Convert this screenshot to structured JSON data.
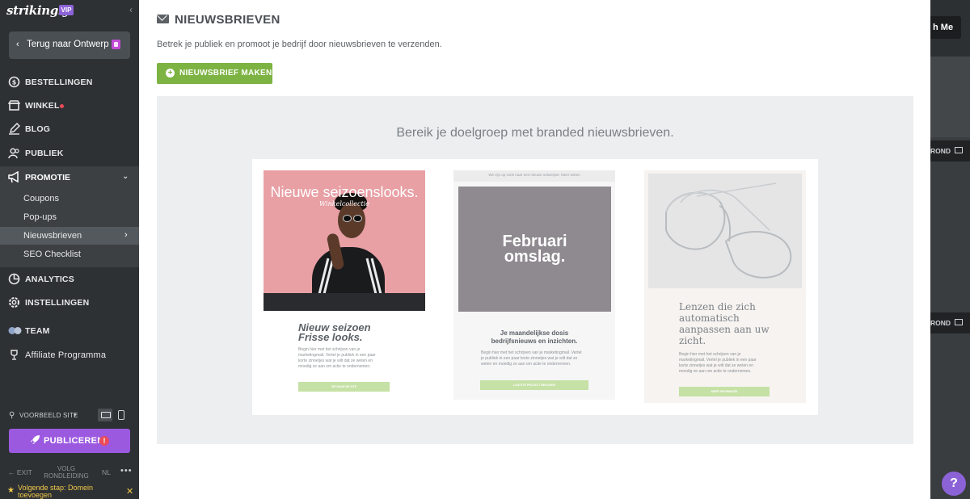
{
  "sidebar": {
    "logo": "strikingly",
    "vip_badge": "VIP",
    "back_button": "Terug naar Ontwerp",
    "items": [
      {
        "label": "BESTELLINGEN",
        "icon": "dollar-circle-icon"
      },
      {
        "label": "WINKEL",
        "icon": "store-icon",
        "dot": true
      },
      {
        "label": "BLOG",
        "icon": "pen-icon"
      },
      {
        "label": "PUBLIEK",
        "icon": "people-icon"
      }
    ],
    "promotion": {
      "label": "PROMOTIE",
      "icon": "megaphone-icon",
      "sub_items": [
        "Coupons",
        "Pop-ups",
        "Nieuwsbrieven",
        "SEO Checklist"
      ],
      "active": "Nieuwsbrieven"
    },
    "items_after": [
      {
        "label": "ANALYTICS",
        "icon": "pie-chart-icon"
      },
      {
        "label": "INSTELLINGEN",
        "icon": "gear-icon"
      },
      {
        "label": "TEAM",
        "icon": "team-icon"
      },
      {
        "label": "Affiliate Programma",
        "icon": "trophy-icon"
      }
    ],
    "preview_label": "VOORBEELD SITE",
    "publish_label": "PUBLICEREN",
    "publish_warning": "!",
    "exit_label": "EXIT",
    "tour_label": "VOLG RONDLEIDING",
    "lang_label": "NL",
    "more_label": "•••",
    "next_step": "Volgende stap: Domein toevoegen"
  },
  "background": {
    "button_fragment": "h Me",
    "label_fragment_1": "ROND",
    "label_fragment_2": "ROND"
  },
  "help_label": "?",
  "main": {
    "title": "NIEUWSBRIEVEN",
    "subtitle": "Betrek je publiek en promoot je bedrijf door nieuwsbrieven te verzenden.",
    "make_button": "NIEUWSBRIEF MAKEN",
    "promo_heading": "Bereik je doelgroep met branded nieuwsbrieven.",
    "cards": [
      {
        "image_heading": "Nieuwe seizoenslooks.",
        "image_sub": "Winkelcollectie",
        "title": "Nieuw seizoen\nFrisse looks.",
        "body": "Begin hier met het schrijven van je\nmarketingmail. Vertel je publiek in een paar\nkorte zinnetjes wat je wilt dat ze weten en\nmoedig ze aan om actie te ondernemen.",
        "button": "ZIE NAAR DE SITE"
      },
      {
        "top_bar": "We zijn op zoek naar een nieuwe ontwerper. Meer weten",
        "image_heading": "Februari\nomslag.",
        "title": "Je maandelijkse dosis\nbedrijfsnieuws en inzichten.",
        "body": "Begin hier met het schrijven van je marketingmail. Vertel\nje publiek in een paar korte zinnetjes wat je wilt dat ze\nweten en moedig ze aan om actie te ondernemen.",
        "button": "LAATSTE PROJECT BEKIJKEN"
      },
      {
        "title": "Lenzen die zich\nautomatisch\naanpassen aan uw\nzicht.",
        "body": "Begin hier met het schrijven van je\nmarketingmail. Vertel je publiek in een paar\nkorte zinnetjes wat je wilt dat ze weten en\nmoedig ze aan om actie te ondernemen.",
        "button": "MEER INFORMATIE"
      }
    ]
  },
  "colors": {
    "sidebar_bg": "#2e3133",
    "promo_bg": "#3c4043",
    "active_item_bg": "#54595d",
    "accent_purple": "#9b59e0",
    "accent_green": "#7cb342",
    "panel_gray": "#eceeef",
    "card1_pink": "#e8a0a5",
    "card2_gray": "#8e8a8f"
  }
}
